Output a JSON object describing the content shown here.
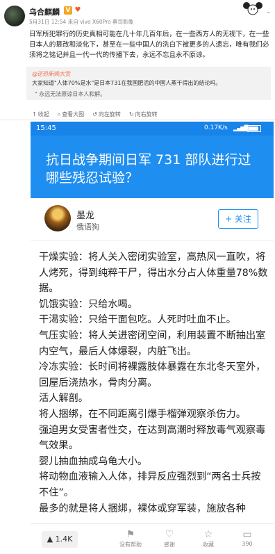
{
  "post": {
    "username": "乌合麒麟",
    "meta": "5月31日 12:54 来自 vivo X60Pro 蔡司影像",
    "body": "日军所犯罪行的历史真相可能在几十年几百年后，在一些西方人的无视下，在一些日本人的篡改和淡化下，甚至在一些中国人的洗白下被更多的人遗忘，唯有我们必须将之铭记并且一代一代的传播下去，永远不忘且永不原谅。",
    "quote": {
      "user": "@逆恐新闻大赏",
      "text": "大家知道\"人体70%是水\"是日本731在我国肥活的中国人蒸干得出的结论吗。",
      "note": "\" 永远无法原谅日本人和解。"
    },
    "actions": {
      "favorite": "收起",
      "view_large": "查看大图",
      "rotate_left": "向左旋转",
      "rotate_right": "向右旋转"
    }
  },
  "phone": {
    "status": {
      "time": "15:45",
      "speed": "0.17K/s"
    },
    "question_title": "抗日战争期间日军 731 部队进行过哪些残忍试验？",
    "author": {
      "name": "墨龙",
      "subtitle": "俄语狗",
      "follow_label": "+ 关注"
    },
    "answer_paragraphs": [
      "干燥实验：将人关入密闭实验室，高热风一直吹，将人烤死，得到纯粹干尸，得出水分占人体重量78%数据。",
      "饥饿实验：只给水喝。",
      "干渴实验：只给干面包吃。人死时吐血不止。",
      "气压实验：将人关进密闭空间，利用装置不断抽出室内空气，最后人体爆裂，内脏飞出。",
      "冷冻实验：长时间将裸露肢体暴露在东北冬天室外，回屋后浇热水，骨肉分离。",
      "活人解剖。",
      "将人捆绑，在不同距离引爆手榴弹观察杀伤力。",
      "强迫男女受害者性交，在达到高潮时释放毒气观察毒气效果。",
      "婴儿抽血抽成乌龟大小。",
      "将动物血液输入人体，排异反应强烈到“两名士兵按不住”。",
      "最多的就是将人捆绑，裸体或穿军装，施放各种"
    ],
    "bottom_bar": {
      "vote_count": "1.4K",
      "no_help": "没有帮助",
      "thanks": "感谢",
      "favorite": "收藏",
      "comments": "390"
    }
  },
  "colors": {
    "zhihu_blue": "#1f8ef1",
    "status_blue": "#1883e9",
    "weibo_orange": "#eb7350"
  }
}
